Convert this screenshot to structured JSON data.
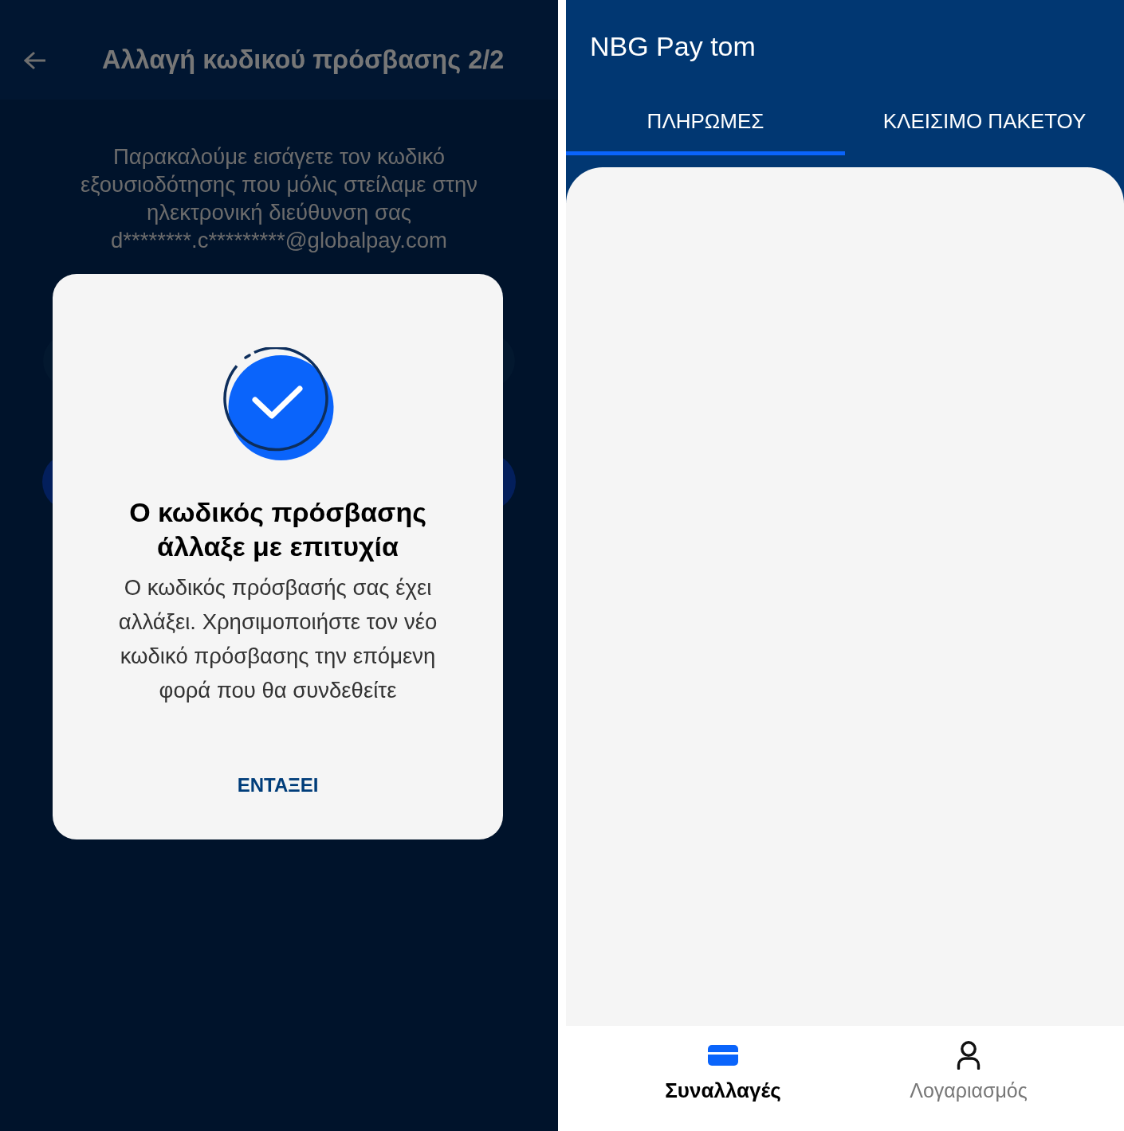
{
  "left_screen": {
    "top_bar": {
      "title": "Αλλαγή κωδικού πρόσβασης 2/2"
    },
    "instructions": "Παρακαλούμε εισάγετε τον κωδικό εξουσιοδότησης που μόλις στείλαμε στην ηλεκτρονική διεύθυνση σας d********.c*********@globalpay.com",
    "dialog": {
      "title": "Ο κωδικός πρόσβασης άλλαξε με επιτυχία",
      "message": "Ο κωδικός πρόσβασής σας έχει αλλάξει. Χρησιμοποιήστε τον νέο κωδικό πρόσβασης την επόμενη φορά που θα συνδεθείτε",
      "button": "ΕΝΤΑΞΕΙ"
    }
  },
  "right_screen": {
    "app_bar": {
      "title": "NBG Pay tom"
    },
    "tabs": [
      {
        "label": "ΠΛΗΡΩΜΕΣ",
        "selected": true
      },
      {
        "label": "ΚΛΕΙΣΙΜΟ ΠΑΚΕΤΟΥ",
        "selected": false
      }
    ],
    "bottom_nav": [
      {
        "label": "Συναλλαγές",
        "selected": true
      },
      {
        "label": "Λογαριασμός",
        "selected": false
      }
    ]
  }
}
